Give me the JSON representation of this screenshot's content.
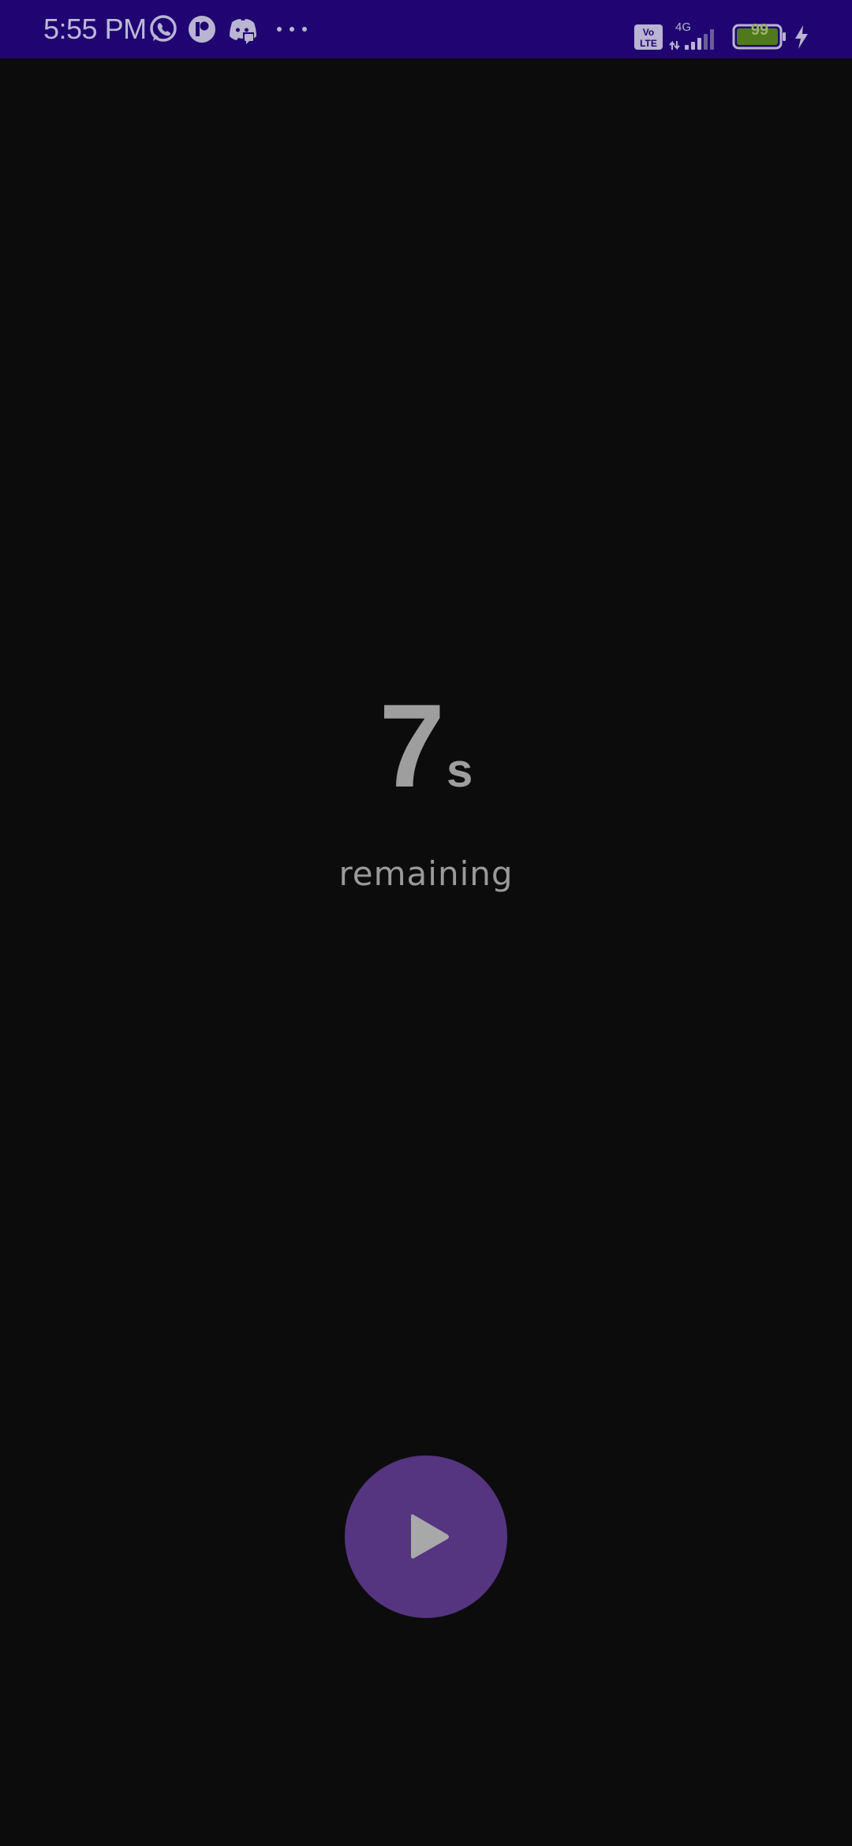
{
  "status_bar": {
    "time": "5:55 PM",
    "network_type": "4G",
    "volte_label": "Vo LTE",
    "battery_level": "99",
    "notification_icons": [
      "whatsapp-icon",
      "app-r-icon",
      "discord-icon",
      "more-dots-icon"
    ],
    "right_icons": [
      "volte-icon",
      "signal-icon",
      "battery-icon",
      "charging-icon"
    ],
    "colors": {
      "background": "#1f0472",
      "foreground": "#b9b4d2",
      "battery_fill": "#4f7a1c"
    }
  },
  "timer": {
    "value": "7",
    "unit": "s",
    "caption": "remaining"
  },
  "controls": {
    "play_icon": "play-icon",
    "button_color": "#553480"
  },
  "colors": {
    "background": "#0c0c0c",
    "text": "#9e9e9e"
  }
}
